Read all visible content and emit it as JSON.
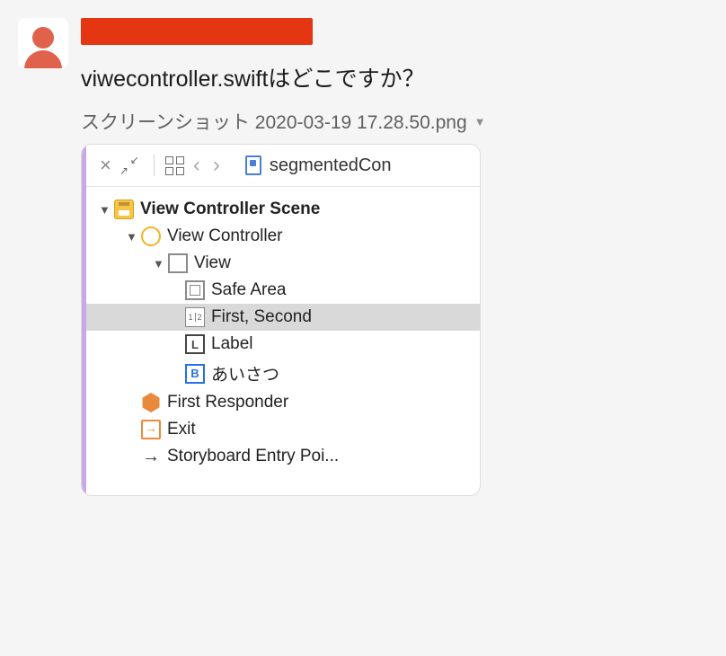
{
  "message": {
    "text": "viwecontroller.swiftはどこですか？"
  },
  "attachment": {
    "filename": "スクリーンショット 2020-03-19 17.28.50.png"
  },
  "toolbar": {
    "tab_title": "segmentedCon"
  },
  "segmented_icon": {
    "one": "1",
    "two": "2"
  },
  "label_icon_char": "L",
  "button_icon_char": "B",
  "arrow_icon_char": "→",
  "outline": {
    "scene": "View Controller Scene",
    "vc": "View Controller",
    "view": "View",
    "safe_area": "Safe Area",
    "segmented": "First, Second",
    "label": "Label",
    "button": "あいさつ",
    "first_responder": "First Responder",
    "exit": "Exit",
    "entry_point": "Storyboard Entry Poi..."
  }
}
